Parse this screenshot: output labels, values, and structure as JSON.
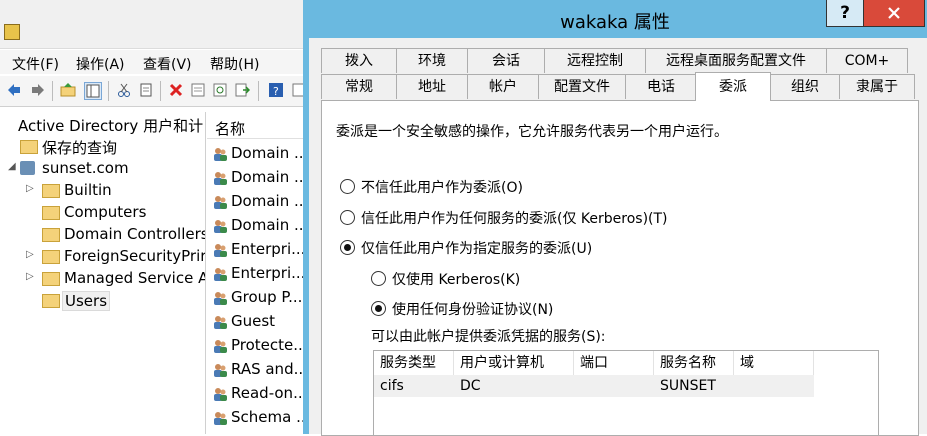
{
  "mmc": {
    "menu": [
      "文件(F)",
      "操作(A)",
      "查看(V)",
      "帮助(H)"
    ],
    "tree": {
      "root": "Active Directory 用户和计",
      "items": [
        {
          "label": "保存的查询",
          "icon": "folder-icon"
        },
        {
          "label": "sunset.com",
          "icon": "domain-icon"
        },
        {
          "label": "Builtin",
          "icon": "folder-icon"
        },
        {
          "label": "Computers",
          "icon": "folder-icon"
        },
        {
          "label": "Domain Controllers",
          "icon": "folder-icon"
        },
        {
          "label": "ForeignSecurityPrir",
          "icon": "folder-icon"
        },
        {
          "label": "Managed Service A",
          "icon": "folder-icon"
        },
        {
          "label": "Users",
          "icon": "folder-icon"
        }
      ]
    },
    "list": {
      "header": "名称",
      "rows": [
        "Domain ...",
        "Domain ...",
        "Domain ...",
        "Domain ...",
        "Enterpri...",
        "Enterpri...",
        "Group P...",
        "Guest",
        "Protecte...",
        "RAS and...",
        "Read-on...",
        "Schema ..."
      ]
    }
  },
  "dialog": {
    "title": "wakaka 属性",
    "help": "?",
    "tabs_row1": [
      "拨入",
      "环境",
      "会话",
      "远程控制",
      "远程桌面服务配置文件",
      "COM+"
    ],
    "tabs_row2": [
      "常规",
      "地址",
      "帐户",
      "配置文件",
      "电话",
      "委派",
      "组织",
      "隶属于"
    ],
    "active_tab": "委派",
    "description": "委派是一个安全敏感的操作，它允许服务代表另一个用户运行。",
    "options": {
      "no_trust": "不信任此用户作为委派(O)",
      "trust_any": "信任此用户作为任何服务的委派(仅 Kerberos)(T)",
      "trust_specified": "仅信任此用户作为指定服务的委派(U)",
      "kerberos_only": "仅使用 Kerberos(K)",
      "any_protocol": "使用任何身份验证协议(N)"
    },
    "selected_option": "trust_specified",
    "selected_protocol": "any_protocol",
    "services_label": "可以由此帐户提供委派凭据的服务(S):",
    "table": {
      "columns": [
        "服务类型",
        "用户或计算机",
        "端口",
        "服务名称",
        "域"
      ],
      "rows": [
        {
          "type": "cifs",
          "host": "DC",
          "port": "",
          "name": "SUNSET",
          "domain": ""
        }
      ]
    }
  },
  "colors": {
    "title_bar": "#6ab9e0",
    "close_button": "#d94a3a"
  }
}
